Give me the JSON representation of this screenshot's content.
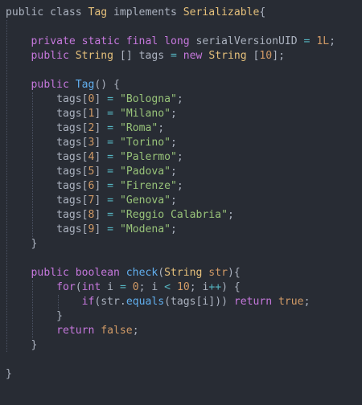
{
  "editor": {
    "theme": {
      "background": "#282c34",
      "text": "#abb2bf",
      "keyword": "#c678dd",
      "type": "#e5c07b",
      "string": "#98c379",
      "number": "#d19a66",
      "function": "#61afef",
      "operator": "#56b6c2",
      "guide": "#4b5263"
    },
    "lines": [
      {
        "tokens": [
          {
            "t": "public class ",
            "c": "plain"
          },
          {
            "t": "Tag",
            "c": "type"
          },
          {
            "t": " implements ",
            "c": "plain"
          },
          {
            "t": "Serializable",
            "c": "type"
          },
          {
            "t": "{",
            "c": "punc"
          }
        ]
      },
      {
        "tokens": []
      },
      {
        "tokens": [
          {
            "t": "    ",
            "c": "plain"
          },
          {
            "t": "private static final long ",
            "c": "kw"
          },
          {
            "t": "serialVersionUID",
            "c": "plain"
          },
          {
            "t": " = ",
            "c": "op"
          },
          {
            "t": "1L",
            "c": "num"
          },
          {
            "t": ";",
            "c": "punc"
          }
        ]
      },
      {
        "tokens": [
          {
            "t": "    ",
            "c": "plain"
          },
          {
            "t": "public ",
            "c": "kw"
          },
          {
            "t": "String",
            "c": "type"
          },
          {
            "t": " [] tags ",
            "c": "plain"
          },
          {
            "t": "=",
            "c": "op"
          },
          {
            "t": " ",
            "c": "plain"
          },
          {
            "t": "new ",
            "c": "kw"
          },
          {
            "t": "String",
            "c": "type"
          },
          {
            "t": " [",
            "c": "plain"
          },
          {
            "t": "10",
            "c": "num"
          },
          {
            "t": "];",
            "c": "plain"
          }
        ]
      },
      {
        "tokens": []
      },
      {
        "tokens": [
          {
            "t": "    ",
            "c": "plain"
          },
          {
            "t": "public ",
            "c": "kw"
          },
          {
            "t": "Tag",
            "c": "fn"
          },
          {
            "t": "() {",
            "c": "punc"
          }
        ]
      },
      {
        "tokens": [
          {
            "t": "        tags[",
            "c": "plain"
          },
          {
            "t": "0",
            "c": "num"
          },
          {
            "t": "] ",
            "c": "plain"
          },
          {
            "t": "=",
            "c": "op"
          },
          {
            "t": " ",
            "c": "plain"
          },
          {
            "t": "\"Bologna\"",
            "c": "str"
          },
          {
            "t": ";",
            "c": "punc"
          }
        ]
      },
      {
        "tokens": [
          {
            "t": "        tags[",
            "c": "plain"
          },
          {
            "t": "1",
            "c": "num"
          },
          {
            "t": "] ",
            "c": "plain"
          },
          {
            "t": "=",
            "c": "op"
          },
          {
            "t": " ",
            "c": "plain"
          },
          {
            "t": "\"Milano\"",
            "c": "str"
          },
          {
            "t": ";",
            "c": "punc"
          }
        ]
      },
      {
        "tokens": [
          {
            "t": "        tags[",
            "c": "plain"
          },
          {
            "t": "2",
            "c": "num"
          },
          {
            "t": "] ",
            "c": "plain"
          },
          {
            "t": "=",
            "c": "op"
          },
          {
            "t": " ",
            "c": "plain"
          },
          {
            "t": "\"Roma\"",
            "c": "str"
          },
          {
            "t": ";",
            "c": "punc"
          }
        ]
      },
      {
        "tokens": [
          {
            "t": "        tags[",
            "c": "plain"
          },
          {
            "t": "3",
            "c": "num"
          },
          {
            "t": "] ",
            "c": "plain"
          },
          {
            "t": "=",
            "c": "op"
          },
          {
            "t": " ",
            "c": "plain"
          },
          {
            "t": "\"Torino\"",
            "c": "str"
          },
          {
            "t": ";",
            "c": "punc"
          }
        ]
      },
      {
        "tokens": [
          {
            "t": "        tags[",
            "c": "plain"
          },
          {
            "t": "4",
            "c": "num"
          },
          {
            "t": "] ",
            "c": "plain"
          },
          {
            "t": "=",
            "c": "op"
          },
          {
            "t": " ",
            "c": "plain"
          },
          {
            "t": "\"Palermo\"",
            "c": "str"
          },
          {
            "t": ";",
            "c": "punc"
          }
        ]
      },
      {
        "tokens": [
          {
            "t": "        tags[",
            "c": "plain"
          },
          {
            "t": "5",
            "c": "num"
          },
          {
            "t": "] ",
            "c": "plain"
          },
          {
            "t": "=",
            "c": "op"
          },
          {
            "t": " ",
            "c": "plain"
          },
          {
            "t": "\"Padova\"",
            "c": "str"
          },
          {
            "t": ";",
            "c": "punc"
          }
        ]
      },
      {
        "tokens": [
          {
            "t": "        tags[",
            "c": "plain"
          },
          {
            "t": "6",
            "c": "num"
          },
          {
            "t": "] ",
            "c": "plain"
          },
          {
            "t": "=",
            "c": "op"
          },
          {
            "t": " ",
            "c": "plain"
          },
          {
            "t": "\"Firenze\"",
            "c": "str"
          },
          {
            "t": ";",
            "c": "punc"
          }
        ]
      },
      {
        "tokens": [
          {
            "t": "        tags[",
            "c": "plain"
          },
          {
            "t": "7",
            "c": "num"
          },
          {
            "t": "] ",
            "c": "plain"
          },
          {
            "t": "=",
            "c": "op"
          },
          {
            "t": " ",
            "c": "plain"
          },
          {
            "t": "\"Genova\"",
            "c": "str"
          },
          {
            "t": ";",
            "c": "punc"
          }
        ]
      },
      {
        "tokens": [
          {
            "t": "        tags[",
            "c": "plain"
          },
          {
            "t": "8",
            "c": "num"
          },
          {
            "t": "] ",
            "c": "plain"
          },
          {
            "t": "=",
            "c": "op"
          },
          {
            "t": " ",
            "c": "plain"
          },
          {
            "t": "\"Reggio Calabria\"",
            "c": "str"
          },
          {
            "t": ";",
            "c": "punc"
          }
        ]
      },
      {
        "tokens": [
          {
            "t": "        tags[",
            "c": "plain"
          },
          {
            "t": "9",
            "c": "num"
          },
          {
            "t": "] ",
            "c": "plain"
          },
          {
            "t": "=",
            "c": "op"
          },
          {
            "t": " ",
            "c": "plain"
          },
          {
            "t": "\"Modena\"",
            "c": "str"
          },
          {
            "t": ";",
            "c": "punc"
          }
        ]
      },
      {
        "tokens": [
          {
            "t": "    }",
            "c": "punc"
          }
        ]
      },
      {
        "tokens": []
      },
      {
        "tokens": [
          {
            "t": "    ",
            "c": "plain"
          },
          {
            "t": "public boolean ",
            "c": "kw"
          },
          {
            "t": "check",
            "c": "fn"
          },
          {
            "t": "(",
            "c": "punc"
          },
          {
            "t": "String",
            "c": "type"
          },
          {
            "t": " str",
            "c": "num"
          },
          {
            "t": "){",
            "c": "punc"
          }
        ]
      },
      {
        "tokens": [
          {
            "t": "        ",
            "c": "plain"
          },
          {
            "t": "for",
            "c": "kw"
          },
          {
            "t": "(",
            "c": "punc"
          },
          {
            "t": "int",
            "c": "kw"
          },
          {
            "t": " i ",
            "c": "plain"
          },
          {
            "t": "=",
            "c": "op"
          },
          {
            "t": " ",
            "c": "plain"
          },
          {
            "t": "0",
            "c": "num"
          },
          {
            "t": "; i ",
            "c": "plain"
          },
          {
            "t": "<",
            "c": "op"
          },
          {
            "t": " ",
            "c": "plain"
          },
          {
            "t": "10",
            "c": "num"
          },
          {
            "t": "; i",
            "c": "plain"
          },
          {
            "t": "++",
            "c": "op"
          },
          {
            "t": ") {",
            "c": "punc"
          }
        ]
      },
      {
        "tokens": [
          {
            "t": "            ",
            "c": "plain"
          },
          {
            "t": "if",
            "c": "kw"
          },
          {
            "t": "(str.",
            "c": "plain"
          },
          {
            "t": "equals",
            "c": "fn"
          },
          {
            "t": "(tags[i])) ",
            "c": "plain"
          },
          {
            "t": "return ",
            "c": "kw"
          },
          {
            "t": "true",
            "c": "num"
          },
          {
            "t": ";",
            "c": "punc"
          }
        ]
      },
      {
        "tokens": [
          {
            "t": "        }",
            "c": "punc"
          }
        ]
      },
      {
        "tokens": [
          {
            "t": "        ",
            "c": "plain"
          },
          {
            "t": "return ",
            "c": "kw"
          },
          {
            "t": "false",
            "c": "num"
          },
          {
            "t": ";",
            "c": "punc"
          }
        ]
      },
      {
        "tokens": [
          {
            "t": "    }",
            "c": "punc"
          }
        ]
      },
      {
        "tokens": []
      },
      {
        "tokens": [
          {
            "t": "}",
            "c": "punc"
          }
        ]
      }
    ]
  }
}
